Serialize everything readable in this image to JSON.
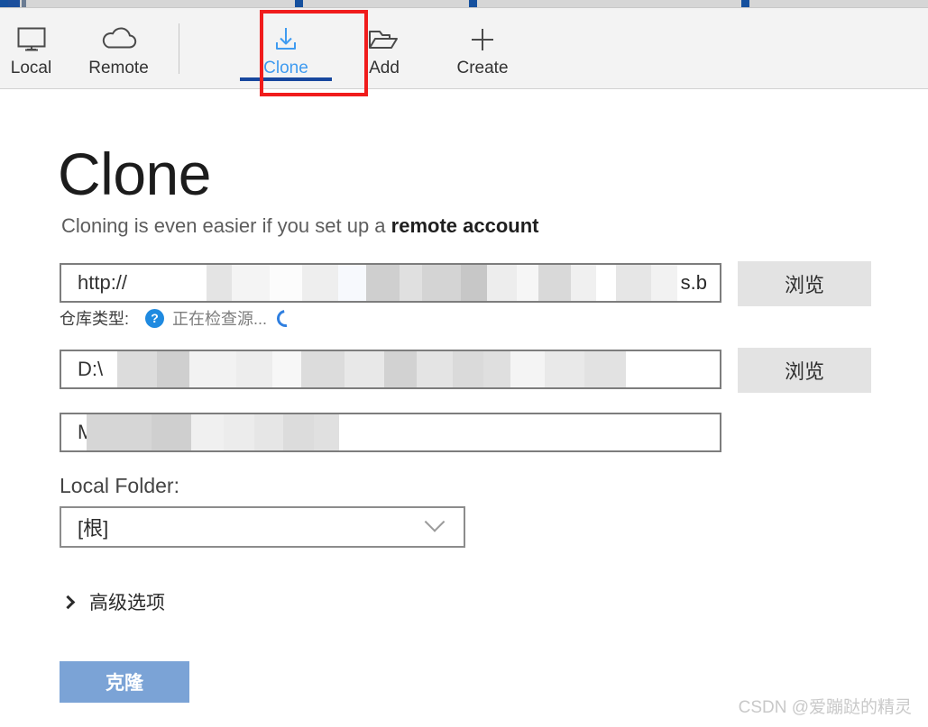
{
  "window": {
    "tab_strip_visible": true
  },
  "toolbar": {
    "items": [
      {
        "id": "local",
        "label": "Local",
        "icon": "monitor-icon",
        "active": false
      },
      {
        "id": "remote",
        "label": "Remote",
        "icon": "cloud-icon",
        "active": false
      },
      {
        "id": "clone",
        "label": "Clone",
        "icon": "download-icon",
        "active": true
      },
      {
        "id": "add",
        "label": "Add",
        "icon": "folder-open-icon",
        "active": false
      },
      {
        "id": "create",
        "label": "Create",
        "icon": "plus-icon",
        "active": false
      }
    ],
    "active_tab": "Clone",
    "highlight_annotation": {
      "target": "Clone",
      "color": "#f01c1c"
    }
  },
  "page": {
    "title": "Clone",
    "subtitle_prefix": "Cloning is even easier if you set up a ",
    "subtitle_link": "remote account"
  },
  "form": {
    "url_field": {
      "visible_text": "http://",
      "trailing_text": "s.b",
      "redacted": true
    },
    "browse_button_1": "浏览",
    "status": {
      "label": "仓库类型:",
      "help_icon": "question-mark-icon",
      "text": "正在检查源...",
      "spinner": "loading-spinner"
    },
    "path_field": {
      "visible_text": "D:\\",
      "redacted": true
    },
    "browse_button_2": "浏览",
    "name_field": {
      "visible_text": "M",
      "redacted": true
    },
    "local_folder": {
      "label": "Local Folder:",
      "value": "[根]",
      "chevron": "chevron-down-icon"
    },
    "advanced": {
      "label": "高级选项",
      "chevron": "chevron-right-icon",
      "expanded": false
    },
    "submit_button": "克隆"
  },
  "watermark": "CSDN @爱蹦跶的精灵",
  "colors": {
    "accent_blue": "#3f9bf0",
    "underline_blue": "#17479e",
    "highlight_red": "#f01c1c",
    "button_blue": "#7ba3d6",
    "toolbar_bg": "#f3f3f3",
    "browse_bg": "#e3e3e3"
  }
}
